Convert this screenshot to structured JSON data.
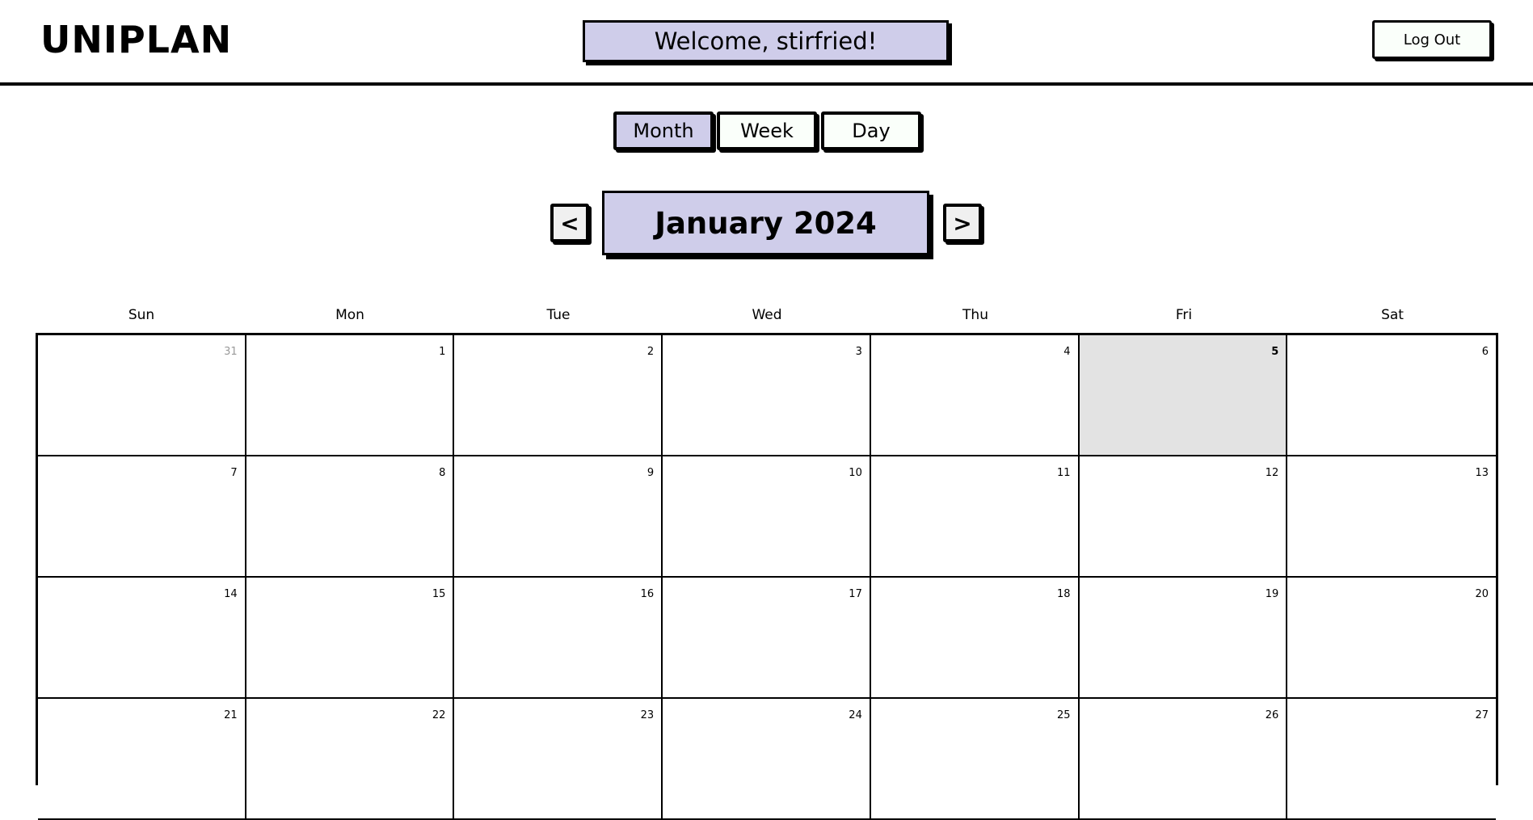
{
  "header": {
    "logo": "UNIPLAN",
    "welcome": "Welcome, stirfried!",
    "logout_label": "Log Out"
  },
  "views": {
    "month": "Month",
    "week": "Week",
    "day": "Day",
    "active": "Month"
  },
  "nav": {
    "prev_label": "<",
    "next_label": ">",
    "title": "January 2024"
  },
  "calendar": {
    "weekdays": [
      "Sun",
      "Mon",
      "Tue",
      "Wed",
      "Thu",
      "Fri",
      "Sat"
    ],
    "weeks": [
      [
        {
          "day": "31",
          "other": true
        },
        {
          "day": "1"
        },
        {
          "day": "2"
        },
        {
          "day": "3"
        },
        {
          "day": "4"
        },
        {
          "day": "5",
          "today": true
        },
        {
          "day": "6"
        }
      ],
      [
        {
          "day": "7"
        },
        {
          "day": "8"
        },
        {
          "day": "9"
        },
        {
          "day": "10"
        },
        {
          "day": "11"
        },
        {
          "day": "12"
        },
        {
          "day": "13"
        }
      ],
      [
        {
          "day": "14"
        },
        {
          "day": "15"
        },
        {
          "day": "16"
        },
        {
          "day": "17"
        },
        {
          "day": "18"
        },
        {
          "day": "19"
        },
        {
          "day": "20"
        }
      ],
      [
        {
          "day": "21"
        },
        {
          "day": "22"
        },
        {
          "day": "23"
        },
        {
          "day": "24"
        },
        {
          "day": "25"
        },
        {
          "day": "26"
        },
        {
          "day": "27"
        }
      ]
    ]
  },
  "colors": {
    "accent": "#cfcdea",
    "today_bg": "#e3e3e3",
    "other_month_text": "#9a9a9a"
  }
}
